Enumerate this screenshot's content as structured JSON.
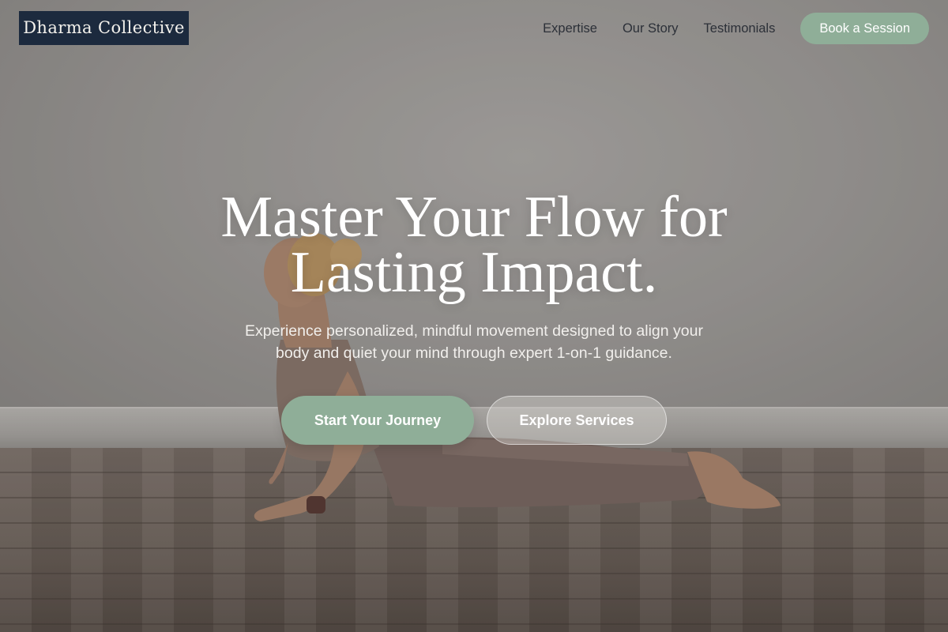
{
  "brand": {
    "name": "Dharma Collective"
  },
  "nav": {
    "links": [
      "Expertise",
      "Our Story",
      "Testimonials"
    ],
    "cta": "Book a Session"
  },
  "hero": {
    "headline_line1": "Master Your Flow for",
    "headline_line2": "Lasting Impact.",
    "subtext_line1": "Experience personalized, mindful movement designed to align your",
    "subtext_line2": "body and quiet your mind through expert 1-on-1 guidance.",
    "primary_cta": "Start Your Journey",
    "secondary_cta": "Explore Services"
  },
  "colors": {
    "brand_bg": "#1c2a3e",
    "accent_sage": "#8fae98",
    "nav_text": "#2c3038"
  }
}
